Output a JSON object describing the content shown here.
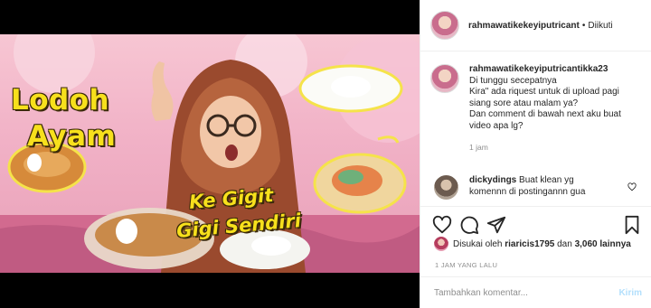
{
  "thumbnail": {
    "title_line1": "Lodoh",
    "title_line2": "Ayam",
    "caption_line1": "Ke Gigit",
    "caption_line2": "Gigi Sendiri"
  },
  "header": {
    "username": "rahmawatikekeyiputricant",
    "separator": "•",
    "follow_label": "Diikuti"
  },
  "caption": {
    "username": "rahmawatikekeyiputricantikka23",
    "lines": [
      "Di tunggu secepatnya",
      "Kira\" ada riquest untuk di upload pagi",
      "siang sore atau malam ya?",
      "Dan comment di bawah next aku buat",
      "video apa lg?"
    ],
    "time": "1 jam"
  },
  "comment": {
    "username": "dickydings",
    "text_line1": "Buat klean yg",
    "text_line2": "komennn di postingannn gua"
  },
  "actions": {
    "like_icon": "heart-icon",
    "comment_icon": "comment-icon",
    "share_icon": "share-icon",
    "save_icon": "bookmark-icon"
  },
  "likes": {
    "prefix": "Disukai oleh",
    "user": "riaricis1795",
    "joiner": "dan",
    "count": "3,060 lainnya"
  },
  "post_time": "1 JAM YANG LALU",
  "add_comment": {
    "placeholder": "Tambahkan komentar...",
    "post_label": "Kirim"
  },
  "colors": {
    "link_disabled": "#b2dffc",
    "muted": "#8e8e8e",
    "title_yellow": "#f7e01c"
  }
}
